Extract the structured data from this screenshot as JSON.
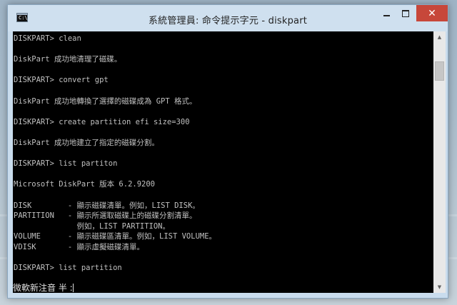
{
  "window": {
    "title": "系統管理員: 命令提示字元 - diskpart",
    "icon": "cmd-icon",
    "close_label": "✕"
  },
  "console": {
    "lines": [
      {
        "row": 1,
        "text": "DISKPART> clean"
      },
      {
        "row": 3,
        "text": "DiskPart 成功地清理了磁碟。"
      },
      {
        "row": 5,
        "text": "DISKPART> convert gpt"
      },
      {
        "row": 7,
        "text": "DiskPart 成功地轉換了選擇的磁碟成為 GPT 格式。"
      },
      {
        "row": 9,
        "text": "DISKPART> create partition efi size=300"
      },
      {
        "row": 11,
        "text": "DiskPart 成功地建立了指定的磁碟分割。"
      },
      {
        "row": 13,
        "text": "DISKPART> list partiton"
      },
      {
        "row": 15,
        "text": "Microsoft DiskPart 版本 6.2.9200"
      },
      {
        "row": 17,
        "text": "DISK        - 顯示磁碟清單。例如，LIST DISK。"
      },
      {
        "row": 18,
        "text": "PARTITION   - 顯示所選取磁碟上的磁碟分割清單。"
      },
      {
        "row": 19,
        "text": "              例如，LIST PARTITION。"
      },
      {
        "row": 20,
        "text": "VOLUME      - 顯示磁碟區清單。例如，LIST VOLUME。"
      },
      {
        "row": 21,
        "text": "VDISK       - 顯示虛擬磁碟清單。"
      },
      {
        "row": 23,
        "text": "DISKPART> list partition"
      }
    ],
    "ime_text": "微軟新注音 半 :"
  },
  "colors": {
    "console_bg": "#000000",
    "console_fg": "#c0c0c0",
    "titlebar": "#cfe0ef",
    "close_button": "#c7473a"
  }
}
